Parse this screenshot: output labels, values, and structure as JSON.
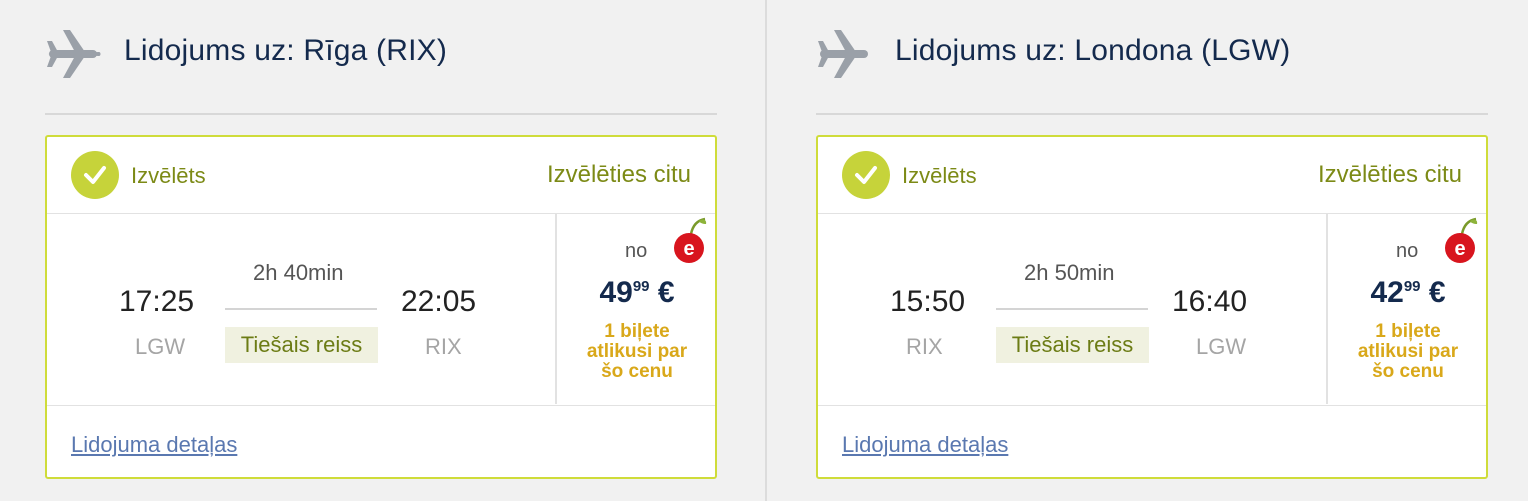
{
  "flights": [
    {
      "heading": "Lidojums uz: Rīga (RIX)",
      "selected_label": "Izvēlēts",
      "choose_other_label": "Izvēlēties citu",
      "departure_time": "17:25",
      "departure_code": "LGW",
      "duration": "2h 40min",
      "direct_label": "Tiešais reiss",
      "arrival_time": "22:05",
      "arrival_code": "RIX",
      "from_label": "no",
      "price_whole": "49",
      "price_cents": "99",
      "currency": "€",
      "seats_line1": "1 biļete",
      "seats_line2": "atlikusi par",
      "seats_line3": "šo cenu",
      "details_link": "Lidojuma detaļas"
    },
    {
      "heading": "Lidojums uz: Londona (LGW)",
      "selected_label": "Izvēlēts",
      "choose_other_label": "Izvēlēties citu",
      "departure_time": "15:50",
      "departure_code": "RIX",
      "duration": "2h 50min",
      "direct_label": "Tiešais reiss",
      "arrival_time": "16:40",
      "arrival_code": "LGW",
      "from_label": "no",
      "price_whole": "42",
      "price_cents": "99",
      "currency": "€",
      "seats_line1": "1 biļete",
      "seats_line2": "atlikusi par",
      "seats_line3": "šo cenu",
      "details_link": "Lidojuma detaļas"
    }
  ],
  "icons": {
    "plane": "airplane-icon",
    "check": "checkmark-icon",
    "cherry": "e-cherry-icon"
  },
  "colors": {
    "accent_green": "#c6d33a",
    "text_green": "#7c8a16",
    "price_navy": "#142a4d",
    "seats_amber": "#d9a81a",
    "cherry_red": "#d8151e",
    "link_blue": "#5a78b0"
  }
}
